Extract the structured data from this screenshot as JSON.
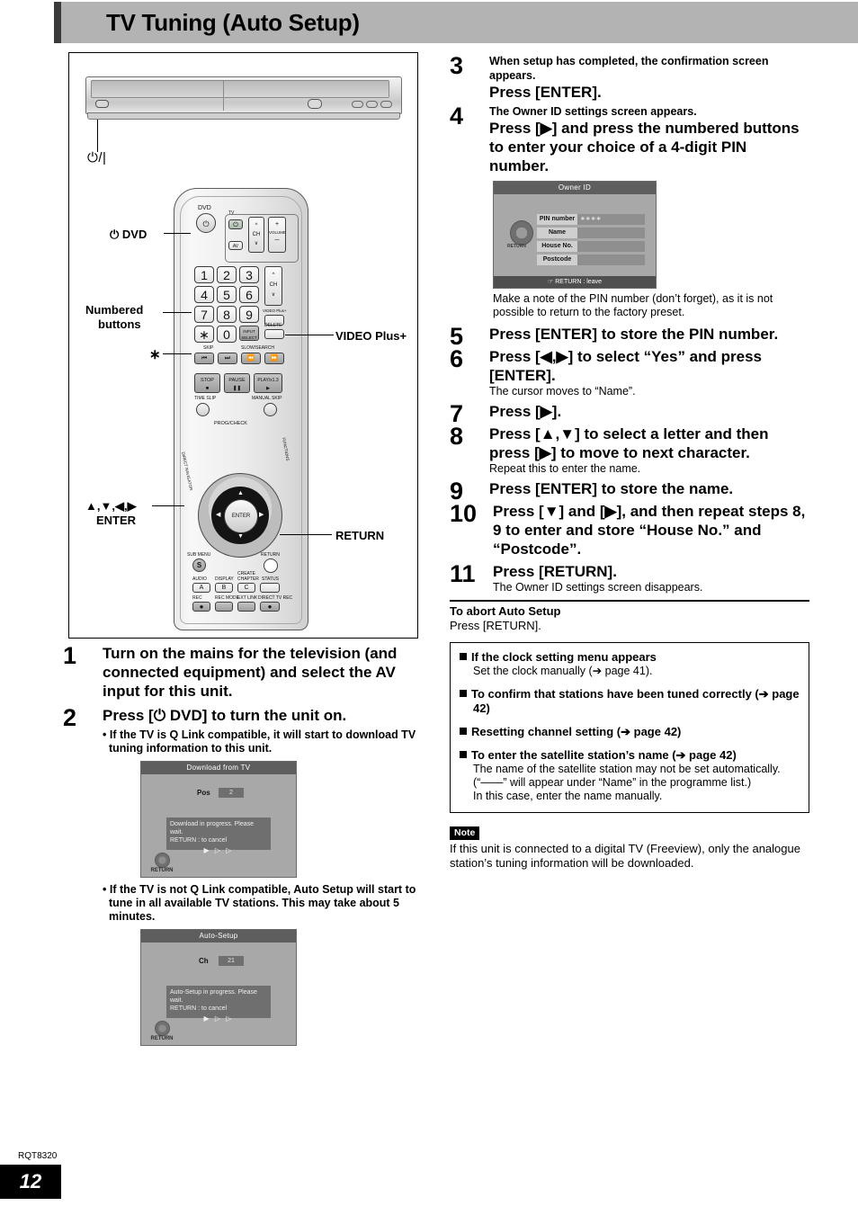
{
  "header": {
    "title": "TV Tuning (Auto Setup)"
  },
  "figure": {
    "unit_power_label": "⏻/|",
    "callouts": {
      "dvd": "⏻ DVD",
      "numbered_buttons_line1": "Numbered",
      "numbered_buttons_line2": "buttons",
      "asterisk": "∗",
      "video_plus": "VIDEO Plus+",
      "cursor_line1": "▲,▼,◀,▶",
      "cursor_line2": "ENTER",
      "return": "RETURN"
    },
    "remote": {
      "dvd_text": "DVD",
      "tv_text": "TV",
      "av_text": "AV",
      "ch_text": "CH",
      "volume_text": "VOLUME",
      "plus": "+",
      "minus": "−",
      "keys": [
        "1",
        "2",
        "3",
        "4",
        "5",
        "6",
        "7",
        "8",
        "9",
        "∗",
        "0"
      ],
      "input_select_line1": "INPUT",
      "input_select_line2": "SELECT",
      "delete_text": "DELETE",
      "video_plus_text": "VIDEO Plus+",
      "skip_text": "SKIP",
      "slow_search_text": "SLOW/SEARCH",
      "stop_text": "STOP",
      "pause_text": "PAUSE",
      "play_text": "PLAY/x1.3",
      "time_slip_text": "TIME SLIP",
      "manual_skip_text": "MANUAL SKIP",
      "prog_check_text": "PROG/CHECK",
      "direct_navigator_text": "DIRECT NAVIGATOR",
      "functions_text": "FUNCTIONS",
      "enter_text": "ENTER",
      "sub_menu_text": "SUB MENU",
      "sub_menu_key": "S",
      "return_text": "RETURN",
      "audio_text": "AUDIO",
      "audio_key": "A",
      "display_text": "DISPLAY",
      "display_key": "B",
      "create_chapter_line1": "CREATE",
      "create_chapter_line2": "CHAPTER",
      "create_chapter_key": "C",
      "status_text": "STATUS",
      "rec_text": "REC",
      "rec_mode_text": "REC MODE",
      "ext_link_text": "EXT LINK",
      "direct_tv_rec_text": "DIRECT TV REC"
    }
  },
  "left_steps": [
    {
      "num": "1",
      "title": "Turn on the mains for the television (and connected equipment) and select the AV input for this unit."
    },
    {
      "num": "2",
      "title": "Press [⏻ DVD] to turn the unit on.",
      "bullet1": "• If the TV is Q Link compatible, it will start to download TV tuning information to this unit.",
      "bullet2": "• If the TV is not Q Link compatible, Auto Setup will start to tune in all available TV stations. This may take about 5 minutes."
    }
  ],
  "osd_download": {
    "title": "Download from TV",
    "field_label": "Pos",
    "field_value": "2",
    "message_line1": "Download in progress. Please wait.",
    "message_line2": "RETURN : to cancel",
    "arrows": "▶ ▷ ▷",
    "return_label": "RETURN"
  },
  "osd_autosetup": {
    "title": "Auto-Setup",
    "field_label": "Ch",
    "field_value": "21",
    "message_line1": "Auto-Setup in progress. Please wait.",
    "message_line2": "RETURN : to cancel",
    "arrows": "▶ ▷ ▷",
    "return_label": "RETURN"
  },
  "right_steps": [
    {
      "num": "3",
      "pre": "When setup has completed, the confirmation screen appears.",
      "title": "Press [ENTER].",
      "post": ""
    },
    {
      "num": "4",
      "pre": "The Owner ID settings screen appears.",
      "title": "Press [▶] and press the numbered buttons to enter your choice of a 4-digit PIN number.",
      "post": ""
    },
    {
      "num": "5",
      "pre": "",
      "title": "Press [ENTER] to store the PIN number.",
      "post": ""
    },
    {
      "num": "6",
      "pre": "",
      "title": "Press [◀,▶] to select “Yes” and press [ENTER].",
      "post": "The cursor moves to “Name”."
    },
    {
      "num": "7",
      "pre": "",
      "title": "Press [▶].",
      "post": ""
    },
    {
      "num": "8",
      "pre": "",
      "title": "Press [▲,▼] to select a letter and then press [▶] to move to next character.",
      "post": "Repeat this to enter the name."
    },
    {
      "num": "9",
      "pre": "",
      "title": "Press [ENTER] to store the name.",
      "post": ""
    },
    {
      "num": "10",
      "pre": "",
      "title": "Press [▼] and [▶], and then repeat steps 8, 9 to enter and store “House No.” and “Postcode”.",
      "post": ""
    },
    {
      "num": "11",
      "pre": "",
      "title": "Press [RETURN].",
      "post": "The Owner ID settings screen disappears."
    }
  ],
  "osd_owner_id": {
    "title": "Owner ID",
    "rows": [
      {
        "label": "PIN number",
        "value": "∗∗∗∗"
      },
      {
        "label": "Name",
        "value": ""
      },
      {
        "label": "House No.",
        "value": ""
      },
      {
        "label": "Postcode",
        "value": ""
      }
    ],
    "return_label": "RETURN",
    "footer": "RETURN  :  leave"
  },
  "pin_note": "Make a note of the PIN number (don’t forget), as it is not possible to return to the factory preset.",
  "abort": {
    "title": "To abort Auto Setup",
    "body": "Press [RETURN]."
  },
  "info_box": [
    {
      "head": "If the clock setting menu appears",
      "text": "Set the clock manually (➔ page 41)."
    },
    {
      "head": "To confirm that stations have been tuned correctly (➔ page 42)",
      "text": ""
    },
    {
      "head": "Resetting channel setting (➔ page 42)",
      "text": ""
    },
    {
      "head": "To enter the satellite station’s name (➔ page 42)",
      "text": "The name of the satellite station may not be set automatically.\n(“——” will appear under “Name” in the programme list.)\nIn this case, enter the name manually."
    }
  ],
  "note": {
    "tag": "Note",
    "text": "If this unit is connected to a digital TV (Freeview), only the analogue station’s tuning information will be downloaded."
  },
  "footer": {
    "code": "RQT8320",
    "page": "12"
  }
}
